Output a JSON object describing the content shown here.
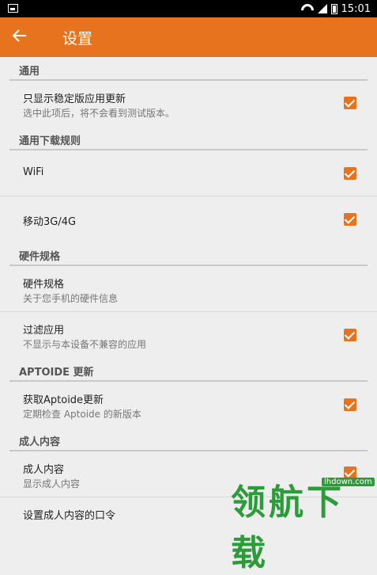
{
  "status_bar": {
    "time": "15:01"
  },
  "app_bar": {
    "title": "设置"
  },
  "sections": {
    "general": {
      "header": "通用"
    },
    "download": {
      "header": "通用下载规则"
    },
    "hardware": {
      "header": "硬件规格"
    },
    "aptoide": {
      "header": "APTOIDE 更新"
    },
    "adult": {
      "header": "成人内容"
    }
  },
  "items": {
    "stable_only": {
      "title": "只显示稳定版应用更新",
      "summary": "选中此项后，将不会看到测试版本。",
      "checked": true
    },
    "wifi": {
      "title": "WiFi",
      "checked": true
    },
    "mobile": {
      "title": "移动3G/4G",
      "checked": true
    },
    "hardware_specs": {
      "title": "硬件规格",
      "summary": "关于您手机的硬件信息"
    },
    "filter_apps": {
      "title": "过滤应用",
      "summary": "不显示与本设备不兼容的应用",
      "checked": true
    },
    "get_updates": {
      "title": "获取Aptoide更新",
      "summary": "定期检查 Aptoide 的新版本",
      "checked": true
    },
    "adult_content": {
      "title": "成人内容",
      "summary": "显示成人内容",
      "checked": true
    },
    "adult_pin": {
      "title": "设置成人内容的口令"
    }
  },
  "watermark": {
    "text": "领航下载",
    "url": "lhdown.com"
  },
  "colors": {
    "accent": "#e8731e",
    "background": "#eeeeee",
    "watermark": "#2c9b3a"
  }
}
